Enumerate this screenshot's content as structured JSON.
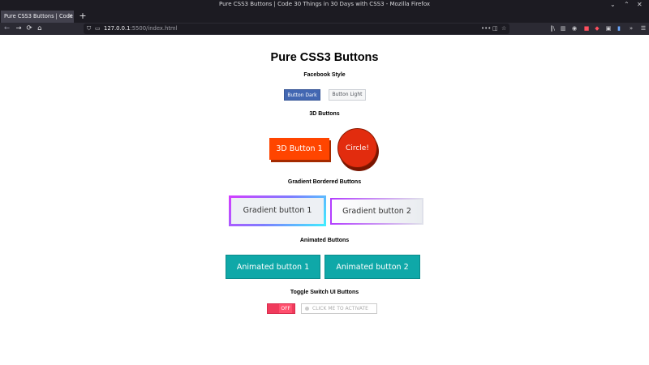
{
  "window": {
    "title": "Pure CSS3 Buttons | Code 30 Things in 30 Days with CSS3 - Mozilla Firefox",
    "minimize": "⌄",
    "maximize": "⌃",
    "close": "✕"
  },
  "tabs": [
    {
      "label": "Pure CSS3 Buttons | Code",
      "close": "✕"
    }
  ],
  "new_tab": "+",
  "nav": {
    "back": "←",
    "forward": "→",
    "reload": "⟳",
    "home": "⌂",
    "url_host": "127.0.0.1",
    "url_rest": ":5500/index.html"
  },
  "page": {
    "title": "Pure CSS3 Buttons",
    "sections": {
      "facebook": {
        "heading": "Facebook Style",
        "dark": "Button Dark",
        "light": "Button Light"
      },
      "threed": {
        "heading": "3D Buttons",
        "button": "3D Button 1",
        "circle": "Circle!"
      },
      "gradient": {
        "heading": "Gradient Bordered Buttons",
        "button1": "Gradient button 1",
        "button2": "Gradient button 2"
      },
      "animated": {
        "heading": "Animated Buttons",
        "button1": "Animated button 1",
        "button2": "Animated button 2"
      },
      "toggle": {
        "heading": "Toggle Switch UI Buttons",
        "state": "OFF",
        "activate": "CLICK ME TO ACTIVATE"
      }
    }
  },
  "colors": {
    "facebook_dark": "#4267b2",
    "threed": "#ff4500",
    "circle": "#e22c0e",
    "animated": "#0fa8a8",
    "toggle_off": "#f03b5c"
  }
}
